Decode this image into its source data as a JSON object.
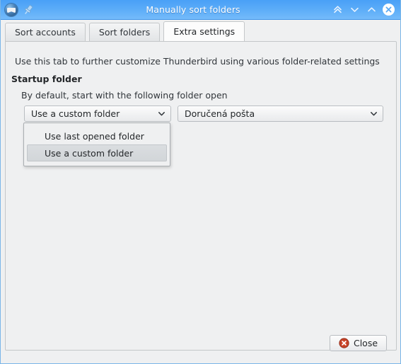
{
  "window": {
    "title": "Manually sort folders",
    "app_icon": "thunderbird-icon",
    "pin_icon": "pin-icon",
    "buttons": [
      {
        "name": "keep-above-button",
        "icon": "double-chevron-up-icon"
      },
      {
        "name": "minimize-button",
        "icon": "chevron-down-icon"
      },
      {
        "name": "maximize-button",
        "icon": "chevron-up-icon"
      },
      {
        "name": "close-window-button",
        "icon": "close-x-icon"
      }
    ],
    "accent_color": "#5aabf8",
    "content_background": "#eff0f1"
  },
  "tabs": [
    {
      "label": "Sort accounts",
      "selected": false
    },
    {
      "label": "Sort folders",
      "selected": false
    },
    {
      "label": "Extra settings",
      "selected": true
    }
  ],
  "content": {
    "intro": "Use this tab to further customize Thunderbird using various folder-related settings",
    "group_title": "Startup folder",
    "group_description": "By default, start with the following folder open",
    "mode_combo": {
      "value": "Use a custom folder",
      "icon": "chevron-down-icon"
    },
    "folder_combo": {
      "value": "Doručená pošta",
      "icon": "chevron-down-icon"
    },
    "dropdown": {
      "open": true,
      "options": [
        {
          "label": "Use last opened folder",
          "highlighted": false
        },
        {
          "label": "Use a custom folder",
          "highlighted": true
        }
      ]
    }
  },
  "footer": {
    "close_label": "Close",
    "close_icon": "close-circle-icon",
    "close_icon_color": "#c0392b"
  }
}
